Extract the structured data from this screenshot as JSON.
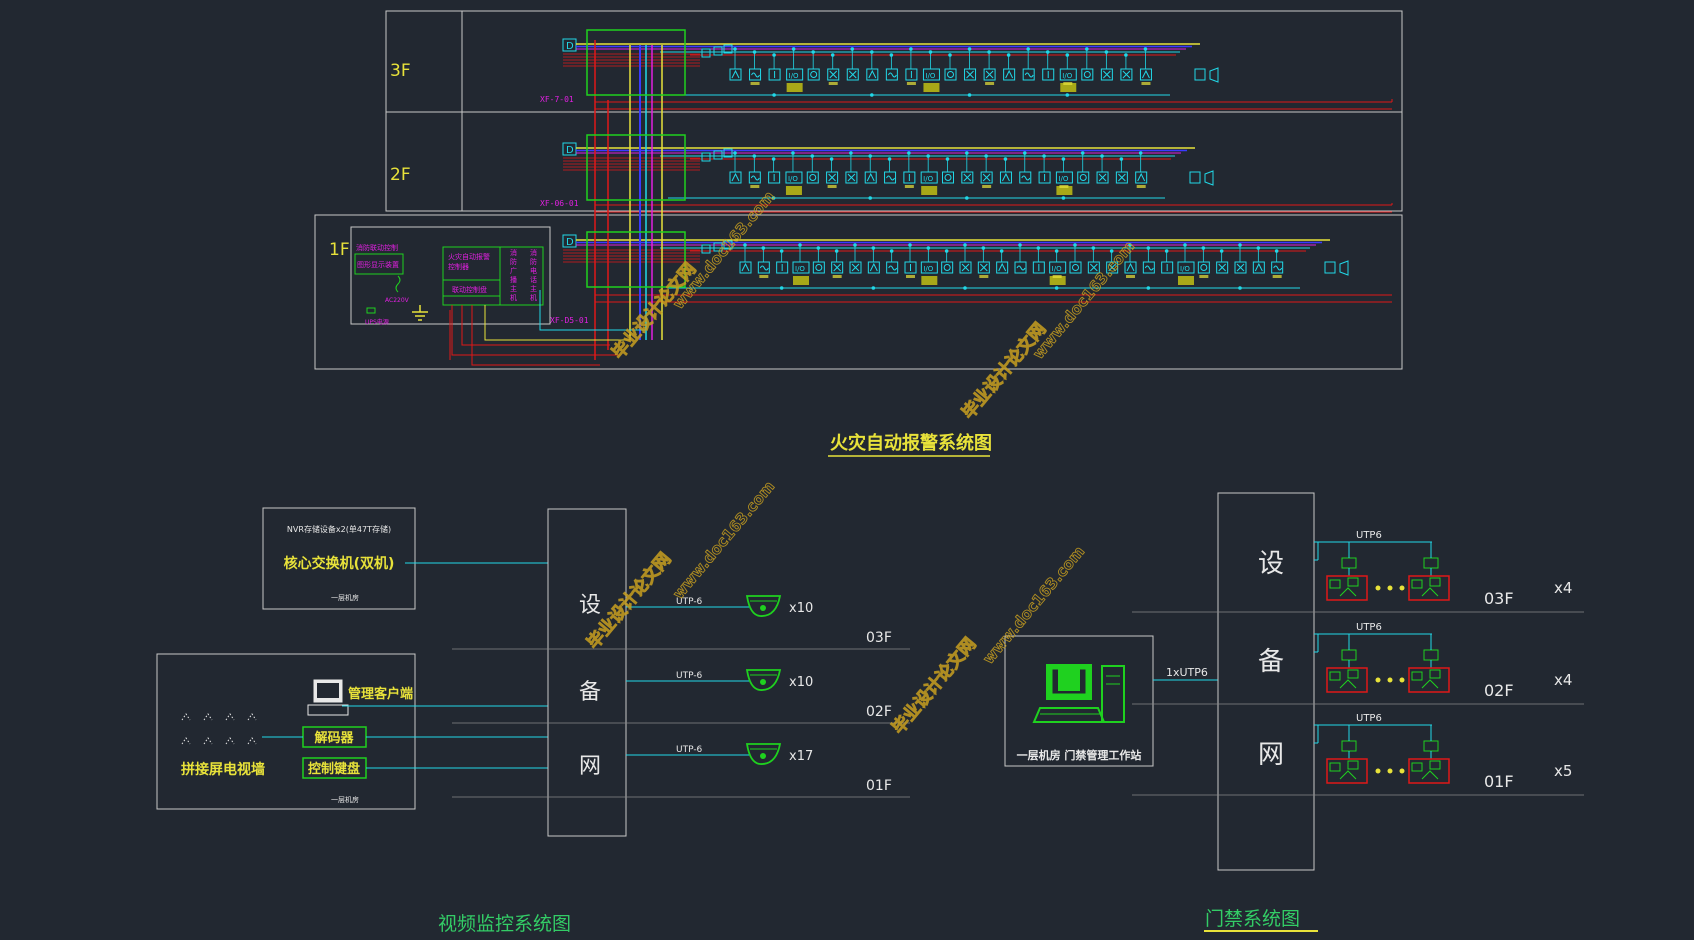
{
  "fire": {
    "title": "火灾自动报警系统图",
    "floors": [
      {
        "label": "3F",
        "panel": "XF-7-01"
      },
      {
        "label": "2F",
        "panel": "XF-06-01"
      },
      {
        "label": "1F",
        "panel": "XF-D5-01"
      }
    ],
    "module_mark": "D",
    "io_label": "I/O",
    "control_room": {
      "left_title": "消防联动控制",
      "left_sub": "图形显示装置",
      "main_title": "火灾自动报警",
      "main_sub": "控制器",
      "panel2": "联动控制盘",
      "col1": "消防广播主机",
      "col2": "消防电话主机",
      "power": "AC220V",
      "ups": "UPS电源"
    }
  },
  "video": {
    "title": "视频监控系统图",
    "nvr": "NVR存储设备x2(单47T存储)",
    "core_switch": "核心交换机(双机)",
    "room1": "一层机房",
    "mgmt_client": "管理客户端",
    "decoder": "解码器",
    "keyboard": "控制键盘",
    "wall": "拼接屏电视墙",
    "room2": "一层机房",
    "network": [
      "设",
      "备",
      "网"
    ],
    "rows": [
      {
        "cable": "UTP-6",
        "count": "x10",
        "floor": "03F"
      },
      {
        "cable": "UTP-6",
        "count": "x10",
        "floor": "02F"
      },
      {
        "cable": "UTP-6",
        "count": "x17",
        "floor": "01F"
      }
    ]
  },
  "access": {
    "title": "门禁系统图",
    "network": [
      "设",
      "备",
      "网"
    ],
    "station": "一层机房 门禁管理工作站",
    "link": "1xUTP6",
    "rows": [
      {
        "cable": "UTP6",
        "floor": "03F",
        "count": "x4"
      },
      {
        "cable": "UTP6",
        "floor": "02F",
        "count": "x4"
      },
      {
        "cable": "UTP6",
        "floor": "01F",
        "count": "x5"
      }
    ]
  },
  "watermark": {
    "text1": "毕业设计论文网",
    "text2": "www.doc163.com"
  },
  "colors": {
    "background": "#222831",
    "frame": "#c8c8c8",
    "bus_red": "#e01818",
    "bus_yellow": "#e8e23a",
    "bus_cyan": "#21d8e8",
    "bus_blue": "#3a3aff",
    "bus_magenta": "#e020e0",
    "green_box": "#1fd11f",
    "title_yellow": "#e8e23a",
    "label_green": "#33cc66"
  }
}
